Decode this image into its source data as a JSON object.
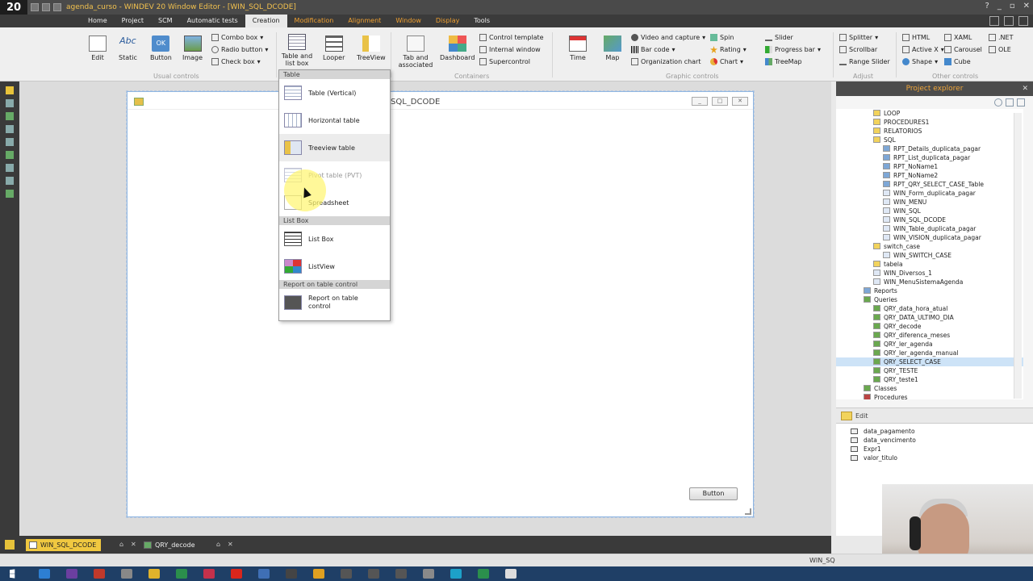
{
  "app": {
    "logo": "20",
    "title": "agenda_curso - WINDEV 20  Window Editor - [WIN_SQL_DCODE]"
  },
  "menu": {
    "items": [
      "Home",
      "Project",
      "SCM",
      "Automatic tests",
      "Creation",
      "Modification",
      "Alignment",
      "Window",
      "Display",
      "Tools"
    ],
    "active_index": 4
  },
  "ribbon": {
    "usual": {
      "edit": "Edit",
      "static": "Static",
      "button": "Button",
      "image": "Image",
      "combo": "Combo box",
      "radio": "Radio button",
      "check": "Check box",
      "static_glyph": "Abc",
      "button_glyph": "OK",
      "group": "Usual controls"
    },
    "tables": {
      "table_list": "Table and list box",
      "looper": "Looper",
      "treeview": "TreeView"
    },
    "containers": {
      "tab": "Tab and associated",
      "dashboard": "Dashboard",
      "control_template": "Control template",
      "internal_window": "Internal window",
      "supercontrol": "Supercontrol",
      "group": "Containers"
    },
    "graphic": {
      "time": "Time",
      "map": "Map",
      "video": "Video and capture",
      "barcode": "Bar code",
      "org": "Organization chart",
      "spin": "Spin",
      "rating": "Rating",
      "chart": "Chart",
      "slider": "Slider",
      "progress": "Progress bar",
      "treemap": "TreeMap",
      "group": "Graphic controls"
    },
    "adjust": {
      "splitter": "Splitter",
      "scrollbar": "Scrollbar",
      "range": "Range Slider",
      "group": "Adjust"
    },
    "other": {
      "html": "HTML",
      "xaml": "XAML",
      "net": ".NET",
      "activex": "Active X",
      "carousel": "Carousel",
      "ole": "OLE",
      "shape": "Shape",
      "cube": "Cube",
      "group": "Other controls"
    }
  },
  "dropdown": {
    "section_table": "Table",
    "table_items": [
      "Table (Vertical)",
      "Horizontal table",
      "Treeview table",
      "Pivot table (PVT)",
      "Spreadsheet"
    ],
    "section_list": "List Box",
    "list_items": [
      "List Box",
      "ListView"
    ],
    "section_report": "Report on table control",
    "report_items": [
      "Report on table control"
    ]
  },
  "window": {
    "title": "SQL_DCODE",
    "button_label": "Button"
  },
  "explorer": {
    "title": "Project explorer",
    "tree": [
      {
        "label": "LOOP",
        "level": 3,
        "icon": "folder"
      },
      {
        "label": "PROCEDURES1",
        "level": 3,
        "icon": "folder"
      },
      {
        "label": "RELATORIOS",
        "level": 3,
        "icon": "folder"
      },
      {
        "label": "SQL",
        "level": 3,
        "icon": "folder"
      },
      {
        "label": "RPT_Details_duplicata_pagar",
        "level": 4,
        "icon": "report"
      },
      {
        "label": "RPT_List_duplicata_pagar",
        "level": 4,
        "icon": "report"
      },
      {
        "label": "RPT_NoName1",
        "level": 4,
        "icon": "report"
      },
      {
        "label": "RPT_NoName2",
        "level": 4,
        "icon": "report"
      },
      {
        "label": "RPT_QRY_SELECT_CASE_Table",
        "level": 4,
        "icon": "report"
      },
      {
        "label": "WIN_Form_duplicata_pagar",
        "level": 4,
        "icon": "window"
      },
      {
        "label": "WIN_MENU",
        "level": 4,
        "icon": "window"
      },
      {
        "label": "WIN_SQL",
        "level": 4,
        "icon": "window"
      },
      {
        "label": "WIN_SQL_DCODE",
        "level": 4,
        "icon": "window"
      },
      {
        "label": "WIN_Table_duplicata_pagar",
        "level": 4,
        "icon": "window"
      },
      {
        "label": "WIN_VISION_duplicata_pagar",
        "level": 4,
        "icon": "window"
      },
      {
        "label": "switch_case",
        "level": 3,
        "icon": "folder"
      },
      {
        "label": "WIN_SWITCH_CASE",
        "level": 4,
        "icon": "window"
      },
      {
        "label": "tabela",
        "level": 3,
        "icon": "folder"
      },
      {
        "label": "WIN_Diversos_1",
        "level": 3,
        "icon": "window"
      },
      {
        "label": "WIN_MenuSistemaAgenda",
        "level": 3,
        "icon": "window"
      },
      {
        "label": "Reports",
        "level": 2,
        "icon": "reports"
      },
      {
        "label": "Queries",
        "level": 2,
        "icon": "queries"
      },
      {
        "label": "QRY_data_hora_atual",
        "level": 3,
        "icon": "query"
      },
      {
        "label": "QRY_DATA_ULTIMO_DIA",
        "level": 3,
        "icon": "query"
      },
      {
        "label": "QRY_decode",
        "level": 3,
        "icon": "query"
      },
      {
        "label": "QRY_diferenca_meses",
        "level": 3,
        "icon": "query"
      },
      {
        "label": "QRY_ler_agenda",
        "level": 3,
        "icon": "query"
      },
      {
        "label": "QRY_ler_agenda_manual",
        "level": 3,
        "icon": "query"
      },
      {
        "label": "QRY_SELECT_CASE",
        "level": 3,
        "icon": "query",
        "selected": true
      },
      {
        "label": "QRY_TESTE",
        "level": 3,
        "icon": "query"
      },
      {
        "label": "QRY_teste1",
        "level": 3,
        "icon": "query"
      },
      {
        "label": "Classes",
        "level": 2,
        "icon": "classes"
      },
      {
        "label": "Procedures",
        "level": 2,
        "icon": "procedures"
      }
    ],
    "edit_label": "Edit",
    "fields": [
      "data_pagamento",
      "data_vencimento",
      "Expr1",
      "valor_titulo"
    ]
  },
  "doc_tabs": [
    {
      "label": "WIN_SQL_DCODE",
      "active": true
    },
    {
      "label": "QRY_decode",
      "active": false
    }
  ],
  "status": {
    "text": "WIN_SQ"
  },
  "colors": {
    "accent": "#f0a63a",
    "menu_bg": "#3b3b3b",
    "tab_active": "#f0c840",
    "selection": "#cde3f7"
  }
}
